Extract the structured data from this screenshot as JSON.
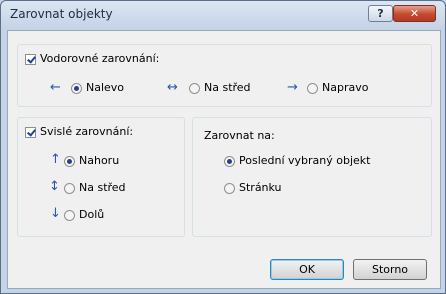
{
  "window": {
    "title": "Zarovnat objekty",
    "help_label": "?",
    "close_label": "✕"
  },
  "horizontal": {
    "checkbox_label": "Vodorovné zarovnání:",
    "checked": true,
    "options": [
      {
        "label": "Nalevo",
        "selected": true,
        "icon": "arrow-left-icon"
      },
      {
        "label": "Na střed",
        "selected": false,
        "icon": "center-horizontal-icon"
      },
      {
        "label": "Napravo",
        "selected": false,
        "icon": "arrow-right-icon"
      }
    ]
  },
  "vertical": {
    "checkbox_label": "Svislé zarovnání:",
    "checked": true,
    "options": [
      {
        "label": "Nahoru",
        "selected": true,
        "icon": "arrow-up-icon"
      },
      {
        "label": "Na střed",
        "selected": false,
        "icon": "center-vertical-icon"
      },
      {
        "label": "Dolů",
        "selected": false,
        "icon": "arrow-down-icon"
      }
    ]
  },
  "align_to": {
    "heading": "Zarovnat na:",
    "options": [
      {
        "label": "Poslední vybraný objekt",
        "selected": true
      },
      {
        "label": "Stránku",
        "selected": false
      }
    ]
  },
  "buttons": {
    "ok": "OK",
    "cancel": "Storno"
  },
  "colors": {
    "arrow": "#2a55b0",
    "title_bar": "#c5d3e6",
    "close_red": "#c44a2f"
  }
}
